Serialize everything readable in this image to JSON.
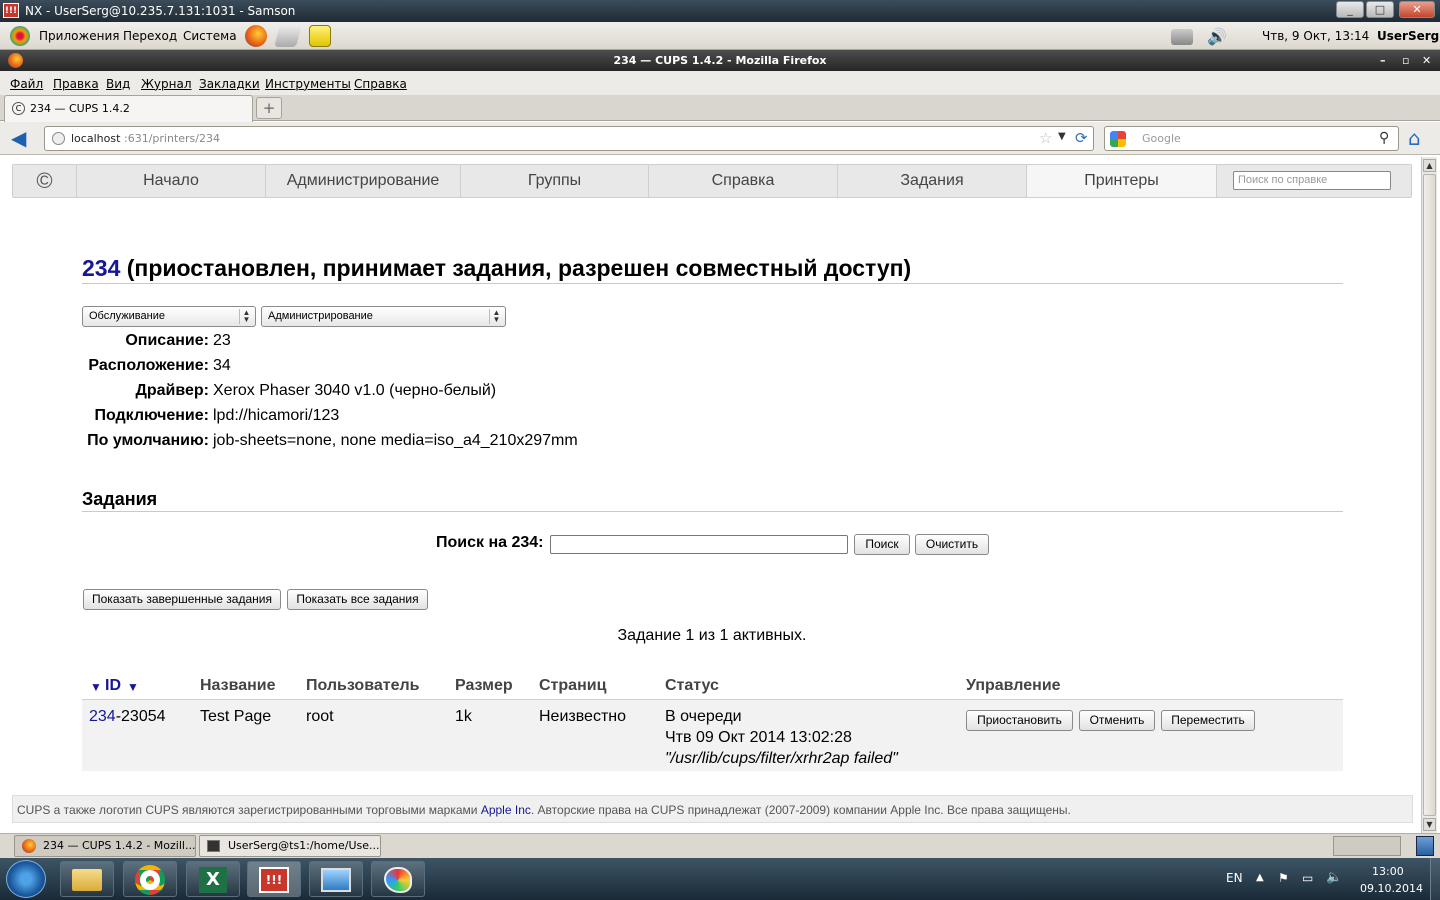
{
  "nx_window": {
    "title": "NX - UserSerg@10.235.7.131:1031 - Samson",
    "logo": "!!!"
  },
  "gnome_panel": {
    "menus": [
      "Приложения",
      "Переход",
      "Система"
    ],
    "clock": "Чтв, 9 Окт, 13:14",
    "user": "UserSerg"
  },
  "firefox": {
    "window_title": "234 — CUPS 1.4.2 - Mozilla Firefox",
    "menu": [
      "Файл",
      "Правка",
      "Вид",
      "Журнал",
      "Закладки",
      "Инструменты",
      "Справка"
    ],
    "tab_title": "234 — CUPS 1.4.2",
    "url_host": "localhost",
    "url_rest": ":631/printers/234",
    "search_placeholder": "Google"
  },
  "cups": {
    "nav_tabs": [
      "Начало",
      "Администрирование",
      "Группы",
      "Справка",
      "Задания",
      "Принтеры"
    ],
    "active_tab": "Принтеры",
    "help_search_placeholder": "Поиск по справке",
    "printer_name": "234",
    "printer_state": "(приостановлен, принимает задания, разрешен совместный доступ)",
    "maintenance_select": "Обслуживание",
    "admin_select": "Администрирование",
    "props": [
      {
        "label": "Описание:",
        "value": "23"
      },
      {
        "label": "Расположение:",
        "value": "34"
      },
      {
        "label": "Драйвер:",
        "value": "Xerox Phaser 3040 v1.0 (черно-белый)"
      },
      {
        "label": "Подключение:",
        "value": "lpd://hicamori/123"
      },
      {
        "label": "По умолчанию:",
        "value": "job-sheets=none, none media=iso_a4_210x297mm"
      }
    ],
    "jobs_heading": "Задания",
    "search_label": "Поиск на 234:",
    "search_value": "",
    "search_button": "Поиск",
    "clear_button": "Очистить",
    "show_completed_button": "Показать завершенные задания",
    "show_all_button": "Показать все задания",
    "jobs_summary": "Задание 1 из 1 активных.",
    "table_headers": [
      "ID",
      "Название",
      "Пользователь",
      "Размер",
      "Страниц",
      "Статус",
      "Управление"
    ],
    "sort_arrow": "▼",
    "job": {
      "id_link": "234",
      "id_suffix": "-23054",
      "name": "Test Page",
      "user": "root",
      "size": "1k",
      "pages": "Неизвестно",
      "status_line1": "В очереди",
      "status_line2": "Чтв 09 Окт 2014 13:02:28",
      "status_line3": "\"/usr/lib/cups/filter/xrhr2ap failed\"",
      "actions": [
        "Приостановить",
        "Отменить",
        "Переместить"
      ]
    },
    "footer_pre": "CUPS а также логотип CUPS являются зарегистрированными торговыми марками ",
    "footer_link": "Apple Inc",
    "footer_post": ". Авторские права на CUPS принадлежат (2007-2009) компании Apple Inc. Все права защищены."
  },
  "taskbar_ff": {
    "items": [
      "234 — CUPS 1.4.2 - Mozill...",
      "UserSerg@ts1:/home/Use..."
    ]
  },
  "windows_taskbar": {
    "lang": "EN",
    "time": "13:00",
    "date": "09.10.2014"
  },
  "colors": {
    "link": "#161699",
    "nx_titlebar": "#2b3a46",
    "win_taskbar": "#2a3d4c"
  }
}
